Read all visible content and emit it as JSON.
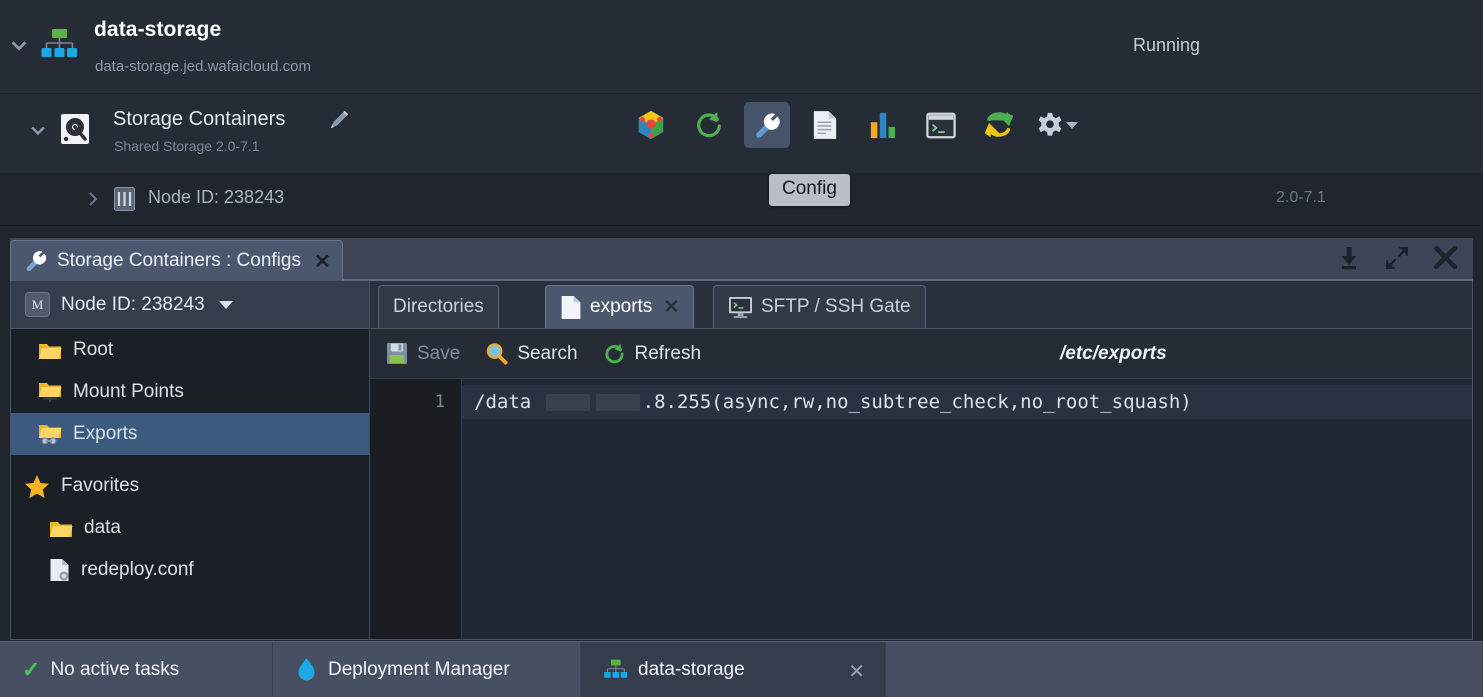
{
  "env_header": {
    "title": "data-storage",
    "domain": "data-storage.jed.wafaicloud.com",
    "status": "Running",
    "env_icon": "environment-topology-icon",
    "collapse_icon": "chevron-down-icon"
  },
  "node_group": {
    "title": "Storage Containers",
    "subtitle": "Shared Storage 2.0-7.1",
    "edit_icon": "pencil-icon",
    "disk_icon": "hard-disk-icon",
    "collapse_icon": "chevron-down-icon",
    "toolbar": [
      {
        "name": "settings-cluster-icon",
        "label": "Cluster"
      },
      {
        "name": "restart-icon",
        "label": "Restart"
      },
      {
        "name": "config-wrench-icon",
        "label": "Config",
        "active": true
      },
      {
        "name": "log-file-icon",
        "label": "Log"
      },
      {
        "name": "statistics-chart-icon",
        "label": "Statistics"
      },
      {
        "name": "web-ssh-terminal-icon",
        "label": "Web SSH"
      },
      {
        "name": "redeploy-icon",
        "label": "Redeploy"
      },
      {
        "name": "additional-gear-icon",
        "label": "Additional"
      }
    ],
    "tooltip": "Config"
  },
  "node_row": {
    "label": "Node ID: 238243",
    "version": "2.0-7.1",
    "expand_icon": "chevron-right-icon",
    "container_icon": "container-icon"
  },
  "panel": {
    "tab_title": "Storage Containers : Configs",
    "tab_icon": "wrench-icon",
    "tab_close": "✕",
    "actions": [
      {
        "name": "download-icon"
      },
      {
        "name": "expand-fullscreen-icon"
      },
      {
        "name": "close-panel-icon"
      }
    ]
  },
  "sidebar": {
    "header": {
      "badge": "M",
      "label": "Node ID: 238243",
      "caret": "chevron-down-icon"
    },
    "items": [
      {
        "label": "Root",
        "icon": "folder-icon",
        "selected": false
      },
      {
        "label": "Mount Points",
        "icon": "folder-mount-icon",
        "selected": false
      },
      {
        "label": "Exports",
        "icon": "folder-exports-icon",
        "selected": true
      }
    ],
    "favorites": {
      "label": "Favorites",
      "icon": "star-icon",
      "items": [
        {
          "label": "data",
          "icon": "folder-icon"
        },
        {
          "label": "redeploy.conf",
          "icon": "config-file-icon"
        }
      ]
    }
  },
  "file_tabs": [
    {
      "label": "Directories",
      "active": false,
      "icon": null,
      "closable": false
    },
    {
      "label": "exports",
      "active": true,
      "icon": "file-icon",
      "closable": true
    },
    {
      "label": "SFTP / SSH Gate",
      "active": false,
      "icon": "terminal-icon",
      "closable": false
    }
  ],
  "editor": {
    "actions": [
      {
        "label": "Save",
        "icon": "save-icon",
        "disabled": true
      },
      {
        "label": "Search",
        "icon": "search-icon",
        "disabled": false
      },
      {
        "label": "Refresh",
        "icon": "refresh-icon",
        "disabled": false
      }
    ],
    "path": "/etc/exports",
    "lines": [
      {
        "number": "1",
        "prefix": "/data ",
        "suffix": ".8.255(async,rw,no_subtree_check,no_root_squash)",
        "redacted": 2
      }
    ]
  },
  "bottom_bar": {
    "tasks": {
      "label": "No active tasks",
      "icon": "check-icon"
    },
    "deployment_manager": {
      "label": "Deployment Manager",
      "icon": "deployment-manager-icon"
    },
    "env_tab": {
      "label": "data-storage",
      "icon": "environment-topology-icon",
      "close": "✕"
    }
  }
}
